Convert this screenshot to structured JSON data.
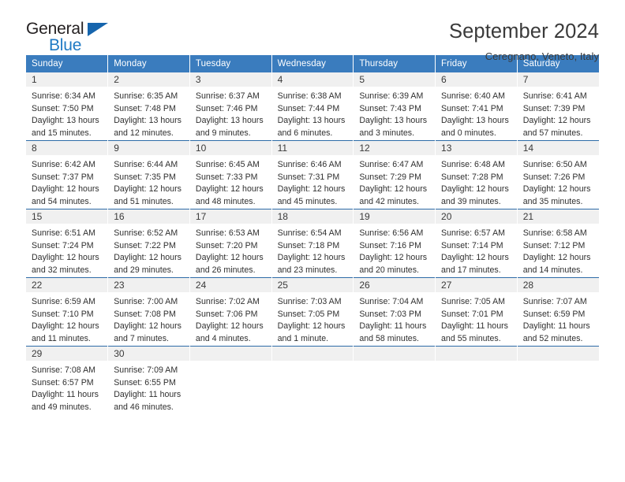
{
  "brand": {
    "name_part1": "General",
    "name_part2": "Blue",
    "triangle_icon": "triangle-icon"
  },
  "header": {
    "title": "September 2024",
    "subtitle": "Ceregnano, Veneto, Italy"
  },
  "colors": {
    "header_blue": "#3a7cbe",
    "row_divider_blue": "#2e6ca8",
    "daynum_band": "#f0f0f0",
    "logo_blue": "#1f7ac4",
    "triangle_blue": "#1665ad",
    "text": "#2f2f2f"
  },
  "calendar": {
    "weekday_headers": [
      "Sunday",
      "Monday",
      "Tuesday",
      "Wednesday",
      "Thursday",
      "Friday",
      "Saturday"
    ],
    "weeks": [
      [
        {
          "day": "1",
          "sunrise": "Sunrise: 6:34 AM",
          "sunset": "Sunset: 7:50 PM",
          "daylight1": "Daylight: 13 hours",
          "daylight2": "and 15 minutes."
        },
        {
          "day": "2",
          "sunrise": "Sunrise: 6:35 AM",
          "sunset": "Sunset: 7:48 PM",
          "daylight1": "Daylight: 13 hours",
          "daylight2": "and 12 minutes."
        },
        {
          "day": "3",
          "sunrise": "Sunrise: 6:37 AM",
          "sunset": "Sunset: 7:46 PM",
          "daylight1": "Daylight: 13 hours",
          "daylight2": "and 9 minutes."
        },
        {
          "day": "4",
          "sunrise": "Sunrise: 6:38 AM",
          "sunset": "Sunset: 7:44 PM",
          "daylight1": "Daylight: 13 hours",
          "daylight2": "and 6 minutes."
        },
        {
          "day": "5",
          "sunrise": "Sunrise: 6:39 AM",
          "sunset": "Sunset: 7:43 PM",
          "daylight1": "Daylight: 13 hours",
          "daylight2": "and 3 minutes."
        },
        {
          "day": "6",
          "sunrise": "Sunrise: 6:40 AM",
          "sunset": "Sunset: 7:41 PM",
          "daylight1": "Daylight: 13 hours",
          "daylight2": "and 0 minutes."
        },
        {
          "day": "7",
          "sunrise": "Sunrise: 6:41 AM",
          "sunset": "Sunset: 7:39 PM",
          "daylight1": "Daylight: 12 hours",
          "daylight2": "and 57 minutes."
        }
      ],
      [
        {
          "day": "8",
          "sunrise": "Sunrise: 6:42 AM",
          "sunset": "Sunset: 7:37 PM",
          "daylight1": "Daylight: 12 hours",
          "daylight2": "and 54 minutes."
        },
        {
          "day": "9",
          "sunrise": "Sunrise: 6:44 AM",
          "sunset": "Sunset: 7:35 PM",
          "daylight1": "Daylight: 12 hours",
          "daylight2": "and 51 minutes."
        },
        {
          "day": "10",
          "sunrise": "Sunrise: 6:45 AM",
          "sunset": "Sunset: 7:33 PM",
          "daylight1": "Daylight: 12 hours",
          "daylight2": "and 48 minutes."
        },
        {
          "day": "11",
          "sunrise": "Sunrise: 6:46 AM",
          "sunset": "Sunset: 7:31 PM",
          "daylight1": "Daylight: 12 hours",
          "daylight2": "and 45 minutes."
        },
        {
          "day": "12",
          "sunrise": "Sunrise: 6:47 AM",
          "sunset": "Sunset: 7:29 PM",
          "daylight1": "Daylight: 12 hours",
          "daylight2": "and 42 minutes."
        },
        {
          "day": "13",
          "sunrise": "Sunrise: 6:48 AM",
          "sunset": "Sunset: 7:28 PM",
          "daylight1": "Daylight: 12 hours",
          "daylight2": "and 39 minutes."
        },
        {
          "day": "14",
          "sunrise": "Sunrise: 6:50 AM",
          "sunset": "Sunset: 7:26 PM",
          "daylight1": "Daylight: 12 hours",
          "daylight2": "and 35 minutes."
        }
      ],
      [
        {
          "day": "15",
          "sunrise": "Sunrise: 6:51 AM",
          "sunset": "Sunset: 7:24 PM",
          "daylight1": "Daylight: 12 hours",
          "daylight2": "and 32 minutes."
        },
        {
          "day": "16",
          "sunrise": "Sunrise: 6:52 AM",
          "sunset": "Sunset: 7:22 PM",
          "daylight1": "Daylight: 12 hours",
          "daylight2": "and 29 minutes."
        },
        {
          "day": "17",
          "sunrise": "Sunrise: 6:53 AM",
          "sunset": "Sunset: 7:20 PM",
          "daylight1": "Daylight: 12 hours",
          "daylight2": "and 26 minutes."
        },
        {
          "day": "18",
          "sunrise": "Sunrise: 6:54 AM",
          "sunset": "Sunset: 7:18 PM",
          "daylight1": "Daylight: 12 hours",
          "daylight2": "and 23 minutes."
        },
        {
          "day": "19",
          "sunrise": "Sunrise: 6:56 AM",
          "sunset": "Sunset: 7:16 PM",
          "daylight1": "Daylight: 12 hours",
          "daylight2": "and 20 minutes."
        },
        {
          "day": "20",
          "sunrise": "Sunrise: 6:57 AM",
          "sunset": "Sunset: 7:14 PM",
          "daylight1": "Daylight: 12 hours",
          "daylight2": "and 17 minutes."
        },
        {
          "day": "21",
          "sunrise": "Sunrise: 6:58 AM",
          "sunset": "Sunset: 7:12 PM",
          "daylight1": "Daylight: 12 hours",
          "daylight2": "and 14 minutes."
        }
      ],
      [
        {
          "day": "22",
          "sunrise": "Sunrise: 6:59 AM",
          "sunset": "Sunset: 7:10 PM",
          "daylight1": "Daylight: 12 hours",
          "daylight2": "and 11 minutes."
        },
        {
          "day": "23",
          "sunrise": "Sunrise: 7:00 AM",
          "sunset": "Sunset: 7:08 PM",
          "daylight1": "Daylight: 12 hours",
          "daylight2": "and 7 minutes."
        },
        {
          "day": "24",
          "sunrise": "Sunrise: 7:02 AM",
          "sunset": "Sunset: 7:06 PM",
          "daylight1": "Daylight: 12 hours",
          "daylight2": "and 4 minutes."
        },
        {
          "day": "25",
          "sunrise": "Sunrise: 7:03 AM",
          "sunset": "Sunset: 7:05 PM",
          "daylight1": "Daylight: 12 hours",
          "daylight2": "and 1 minute."
        },
        {
          "day": "26",
          "sunrise": "Sunrise: 7:04 AM",
          "sunset": "Sunset: 7:03 PM",
          "daylight1": "Daylight: 11 hours",
          "daylight2": "and 58 minutes."
        },
        {
          "day": "27",
          "sunrise": "Sunrise: 7:05 AM",
          "sunset": "Sunset: 7:01 PM",
          "daylight1": "Daylight: 11 hours",
          "daylight2": "and 55 minutes."
        },
        {
          "day": "28",
          "sunrise": "Sunrise: 7:07 AM",
          "sunset": "Sunset: 6:59 PM",
          "daylight1": "Daylight: 11 hours",
          "daylight2": "and 52 minutes."
        }
      ],
      [
        {
          "day": "29",
          "sunrise": "Sunrise: 7:08 AM",
          "sunset": "Sunset: 6:57 PM",
          "daylight1": "Daylight: 11 hours",
          "daylight2": "and 49 minutes."
        },
        {
          "day": "30",
          "sunrise": "Sunrise: 7:09 AM",
          "sunset": "Sunset: 6:55 PM",
          "daylight1": "Daylight: 11 hours",
          "daylight2": "and 46 minutes."
        },
        {
          "day": "",
          "sunrise": "",
          "sunset": "",
          "daylight1": "",
          "daylight2": ""
        },
        {
          "day": "",
          "sunrise": "",
          "sunset": "",
          "daylight1": "",
          "daylight2": ""
        },
        {
          "day": "",
          "sunrise": "",
          "sunset": "",
          "daylight1": "",
          "daylight2": ""
        },
        {
          "day": "",
          "sunrise": "",
          "sunset": "",
          "daylight1": "",
          "daylight2": ""
        },
        {
          "day": "",
          "sunrise": "",
          "sunset": "",
          "daylight1": "",
          "daylight2": ""
        }
      ]
    ]
  }
}
